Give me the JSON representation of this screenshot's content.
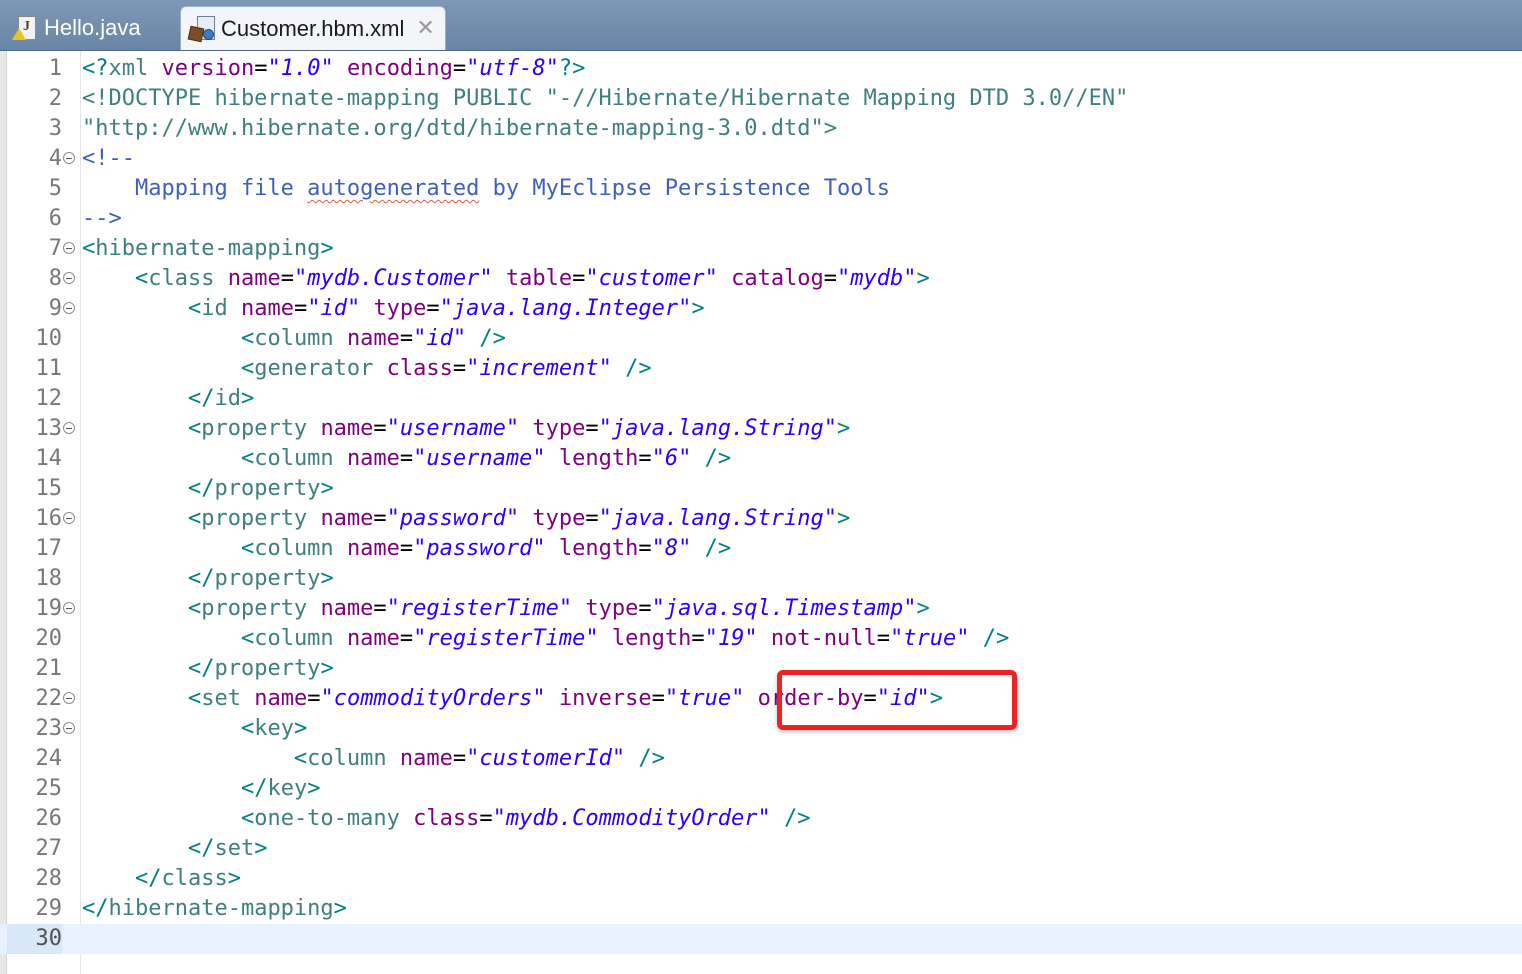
{
  "tabs": [
    {
      "label": "Hello.java",
      "icon": "java-file-warning-icon",
      "active": false
    },
    {
      "label": "Customer.hbm.xml",
      "icon": "hibernate-mapping-file-icon",
      "active": true,
      "close": "✕"
    }
  ],
  "editor": {
    "current_line": 30,
    "line_numbers": [
      "1",
      "2",
      "3",
      "4",
      "5",
      "6",
      "7",
      "8",
      "9",
      "10",
      "11",
      "12",
      "13",
      "14",
      "15",
      "16",
      "17",
      "18",
      "19",
      "20",
      "21",
      "22",
      "23",
      "24",
      "25",
      "26",
      "27",
      "28",
      "29",
      "30"
    ],
    "lines": [
      "<?xml version=\"1.0\" encoding=\"utf-8\"?>",
      "<!DOCTYPE hibernate-mapping PUBLIC \"-//Hibernate/Hibernate Mapping DTD 3.0//EN\"",
      "\"http://www.hibernate.org/dtd/hibernate-mapping-3.0.dtd\">",
      "<!--",
      "    Mapping file autogenerated by MyEclipse Persistence Tools",
      "-->",
      "<hibernate-mapping>",
      "    <class name=\"mydb.Customer\" table=\"customer\" catalog=\"mydb\">",
      "        <id name=\"id\" type=\"java.lang.Integer\">",
      "            <column name=\"id\" />",
      "            <generator class=\"increment\" />",
      "        </id>",
      "        <property name=\"username\" type=\"java.lang.String\">",
      "            <column name=\"username\" length=\"6\" />",
      "        </property>",
      "        <property name=\"password\" type=\"java.lang.String\">",
      "            <column name=\"password\" length=\"8\" />",
      "        </property>",
      "        <property name=\"registerTime\" type=\"java.sql.Timestamp\">",
      "            <column name=\"registerTime\" length=\"19\" not-null=\"true\" />",
      "        </property>",
      "        <set name=\"commodityOrders\" inverse=\"true\" order-by=\"id\">",
      "            <key>",
      "                <column name=\"customerId\" />",
      "            </key>",
      "            <one-to-many class=\"mydb.CommodityOrder\" />",
      "        </set>",
      "    </class>",
      "</hibernate-mapping>",
      ""
    ],
    "folded_lines": [
      4,
      7,
      8,
      9,
      13,
      16,
      19,
      22,
      23
    ],
    "spelling_flag_word": "autogenerated",
    "highlight_annotation": {
      "line": 22,
      "text": "order-by=\"id\">",
      "color": "#ee2222"
    }
  }
}
